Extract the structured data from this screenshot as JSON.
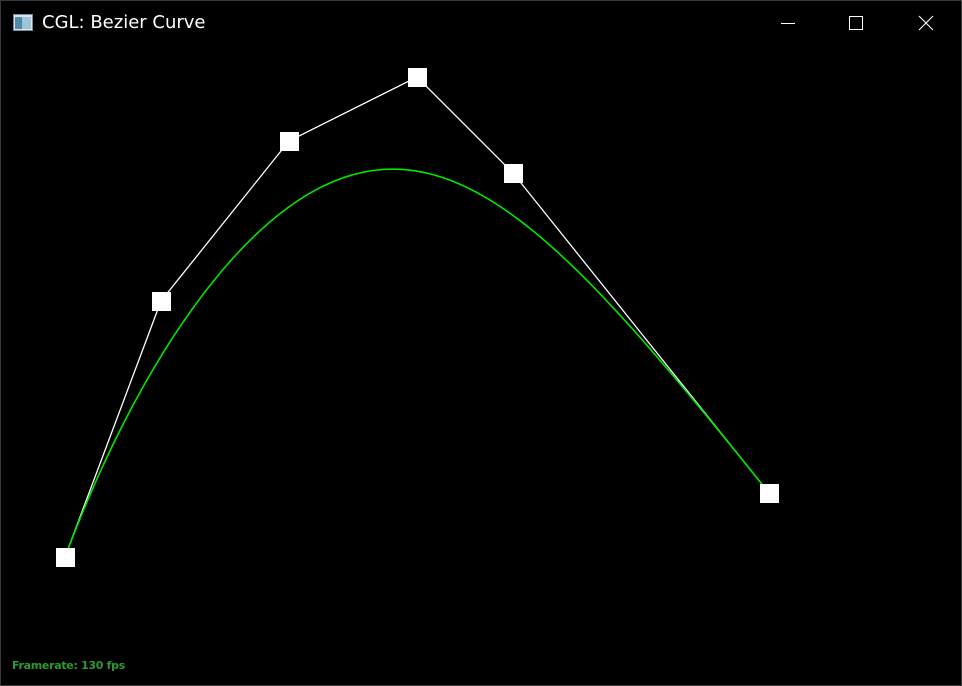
{
  "window": {
    "title": "CGL: Bezier Curve",
    "icon": "app-window-icon",
    "buttons": {
      "minimize_icon": "minimize-icon",
      "maximize_icon": "maximize-icon",
      "close_icon": "close-icon"
    }
  },
  "colors": {
    "background": "#000000",
    "polygon": "#ffffff",
    "curve": "#00ff00",
    "framerate": "#2e9a2e"
  },
  "status": {
    "framerate": "Framerate: 130 fps"
  }
}
